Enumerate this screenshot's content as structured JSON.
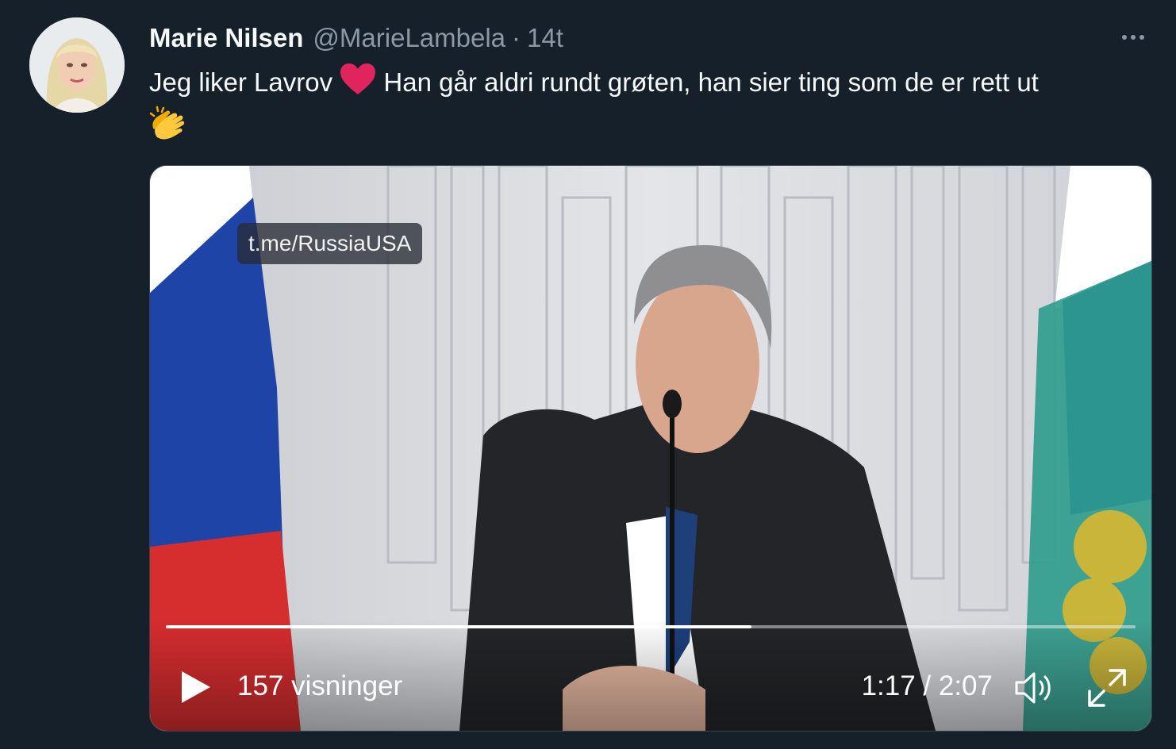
{
  "tweet": {
    "author_name": "Marie Nilsen",
    "handle": "@MarieLambela",
    "separator": "·",
    "time": "14t",
    "text_before_emoji": "Jeg liker Lavrov ",
    "text_after_emoji": " Han går aldri rundt grøten, han sier ting som de er rett ut",
    "emojis": [
      "heart-emoji",
      "clapping-hands-emoji"
    ]
  },
  "video": {
    "watermark": "t.me/RussiaUSA",
    "views": "157 visninger",
    "timecode": "1:17 / 2:07",
    "progress": 0.604
  },
  "icons": {
    "more": "more-options-icon",
    "play": "play-icon",
    "volume": "volume-icon",
    "fullscreen": "fullscreen-icon"
  },
  "colors": {
    "background": "#15202b",
    "secondary_text": "#8b98a5",
    "heart": "#e0245e"
  }
}
